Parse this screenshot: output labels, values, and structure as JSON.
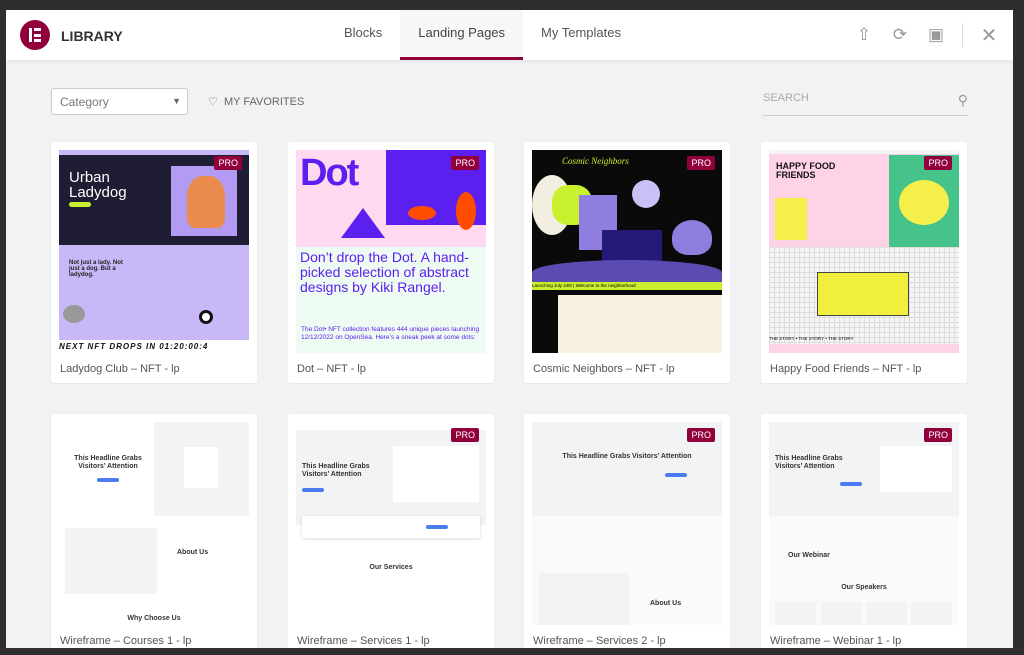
{
  "header": {
    "title": "LIBRARY",
    "tabs": [
      {
        "label": "Blocks"
      },
      {
        "label": "Landing Pages",
        "active": true
      },
      {
        "label": "My Templates"
      }
    ],
    "icons": [
      "upload-icon",
      "sync-icon",
      "save-icon",
      "close-icon"
    ]
  },
  "filters": {
    "category_placeholder": "Category",
    "favorites_label": "MY FAVORITES",
    "search_placeholder": "SEARCH"
  },
  "colors": {
    "accent": "#92003b",
    "pro_badge": "#92003b"
  },
  "pro_label": "PRO",
  "templates": [
    {
      "title": "Ladydog Club – NFT - lp",
      "pro": true,
      "preview": {
        "headline": "Urban Ladydog",
        "sub": "Not just a lady. Not just a dog. But a ladydog.",
        "ticker": "NEXT NFT DROPS IN 01:20:00:4"
      }
    },
    {
      "title": "Dot – NFT - lp",
      "pro": true,
      "preview": {
        "headline": "Dot",
        "sub": "Don’t drop the Dot. A hand-picked selection of abstract designs by Kiki Rangel.",
        "body": "The Dot• NFT collection features 444 unique pieces launching 12/12/2022 on OpenSea. Here’s a sneak peek at some dots:"
      }
    },
    {
      "title": "Cosmic Neighbors – NFT - lp",
      "pro": true,
      "preview": {
        "headline": "Cosmic Neighbors",
        "ticker": "Launching July 24th | Welcome to the neighborhood"
      }
    },
    {
      "title": "Happy Food Friends – NFT - lp",
      "pro": true,
      "preview": {
        "headline": "HAPPY FOOD FRIENDS",
        "ticker": "THE STORY • THE STORY • THE STORY"
      }
    },
    {
      "title": "Wireframe – Courses 1 - lp",
      "pro": false,
      "preview": {
        "headline": "This Headline Grabs Visitors’ Attention",
        "section": "About Us",
        "footer": "Why Choose Us"
      }
    },
    {
      "title": "Wireframe – Services 1 - lp",
      "pro": true,
      "preview": {
        "headline": "This Headline Grabs Visitors’ Attention",
        "section": "Our Services"
      }
    },
    {
      "title": "Wireframe – Services 2 - lp",
      "pro": true,
      "preview": {
        "headline": "This Headline Grabs Visitors’ Attention",
        "section": "About Us"
      }
    },
    {
      "title": "Wireframe – Webinar 1 - lp",
      "pro": true,
      "preview": {
        "headline": "This Headline Grabs Visitors’ Attention",
        "section": "Our Webinar",
        "footer": "Our Speakers"
      }
    }
  ]
}
